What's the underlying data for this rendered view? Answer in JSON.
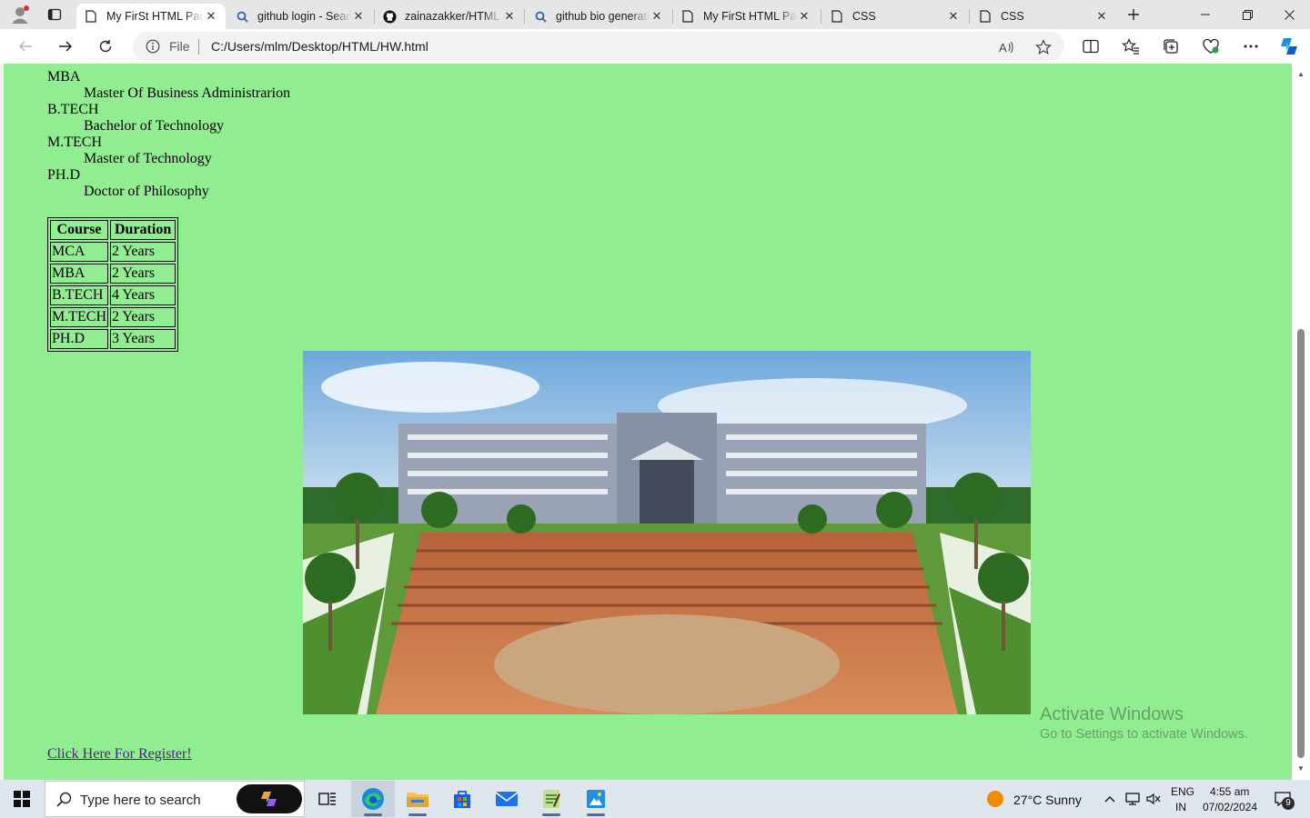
{
  "browser": {
    "tabs": [
      {
        "title": "My FirSt HTML Page",
        "icon": "page-icon",
        "active": true
      },
      {
        "title": "github login - Search",
        "icon": "search-icon",
        "active": false
      },
      {
        "title": "zainazakker/HTML",
        "icon": "github-icon",
        "active": false
      },
      {
        "title": "github bio generator",
        "icon": "search-icon",
        "active": false
      },
      {
        "title": "My FirSt HTML Page",
        "icon": "page-icon",
        "active": false
      },
      {
        "title": "CSS",
        "icon": "page-icon",
        "active": false
      },
      {
        "title": "CSS",
        "icon": "page-icon",
        "active": false
      }
    ],
    "address": {
      "scheme_label": "File",
      "url": "C:/Users/mlm/Desktop/HTML/HW.html"
    }
  },
  "page": {
    "background": "#90ee90",
    "degrees": [
      {
        "abbr": "MBA",
        "full": "Master Of Business Administrarion"
      },
      {
        "abbr": "B.TECH",
        "full": "Bachelor of Technology"
      },
      {
        "abbr": "M.TECH",
        "full": "Master of Technology"
      },
      {
        "abbr": "PH.D",
        "full": "Doctor of Philosophy"
      }
    ],
    "table": {
      "headers": [
        "Course",
        "Duration"
      ],
      "rows": [
        [
          "MCA",
          "2 Years"
        ],
        [
          "MBA",
          "2 Years"
        ],
        [
          "B.TECH",
          "4 Years"
        ],
        [
          "M.TECH",
          "2 Years"
        ],
        [
          "PH.D",
          "3 Years"
        ]
      ]
    },
    "register_link": "Click Here For Register!"
  },
  "watermark": {
    "line1": "Activate Windows",
    "line2": "Go to Settings to activate Windows."
  },
  "taskbar": {
    "search_placeholder": "Type here to search",
    "weather": "27°C  Sunny",
    "lang": "ENG",
    "region": "IN",
    "time": "4:55 am",
    "date": "07/02/2024",
    "notification_count": "9"
  }
}
